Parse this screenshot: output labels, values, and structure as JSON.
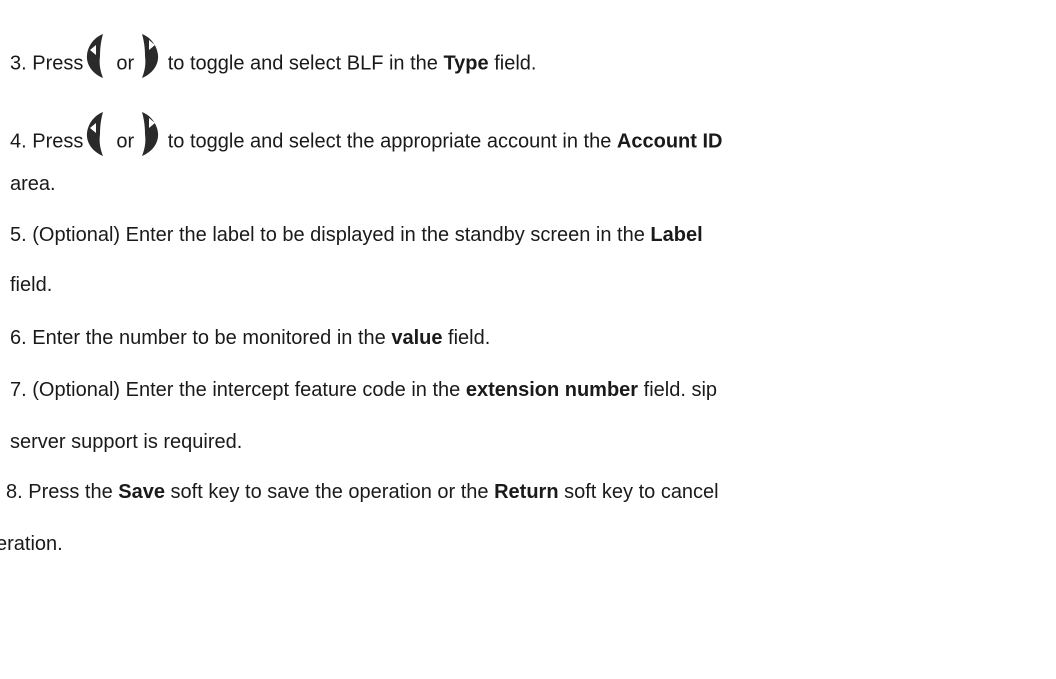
{
  "steps": [
    {
      "id": "step3",
      "parts": [
        {
          "t": "text",
          "v": "3. Press"
        },
        {
          "t": "icon",
          "v": "left-navigation-key-icon"
        },
        {
          "t": "text",
          "v": "or"
        },
        {
          "t": "icon",
          "v": "right-navigation-key-icon"
        },
        {
          "t": "text",
          "v": " to toggle and select BLF in the "
        },
        {
          "t": "bold",
          "v": "Type"
        },
        {
          "t": "text",
          "v": " field."
        }
      ]
    },
    {
      "id": "step4",
      "parts": [
        {
          "t": "text",
          "v": "4. Press"
        },
        {
          "t": "icon",
          "v": "left-navigation-key-icon"
        },
        {
          "t": "text",
          "v": "or"
        },
        {
          "t": "icon",
          "v": "right-navigation-key-icon"
        },
        {
          "t": "text",
          "v": " to toggle and select the appropriate account in the "
        },
        {
          "t": "bold",
          "v": "Account ID"
        }
      ]
    },
    {
      "id": "step4-cont",
      "parts": [
        {
          "t": "text",
          "v": "area."
        }
      ]
    },
    {
      "id": "step5",
      "parts": [
        {
          "t": "text",
          "v": "5. (Optional) Enter the label to be displayed in the standby screen in the "
        },
        {
          "t": "bold",
          "v": "Label"
        }
      ]
    },
    {
      "id": "step5-cont",
      "parts": [
        {
          "t": "text",
          "v": "field."
        }
      ]
    },
    {
      "id": "step6",
      "parts": [
        {
          "t": "text",
          "v": "6. Enter the number to be monitored in the "
        },
        {
          "t": "bold",
          "v": "value"
        },
        {
          "t": "text",
          "v": " field."
        }
      ]
    },
    {
      "id": "step7",
      "parts": [
        {
          "t": "text",
          "v": "7. (Optional) Enter the intercept feature code in the "
        },
        {
          "t": "bold",
          "v": "extension number"
        },
        {
          "t": "text",
          "v": " field. sip"
        }
      ]
    },
    {
      "id": "step7-cont",
      "parts": [
        {
          "t": "text",
          "v": "server support is required."
        }
      ]
    },
    {
      "id": "step8",
      "parts": [
        {
          "t": "text",
          "v": " 8. Press the "
        },
        {
          "t": "bold",
          "v": "Save"
        },
        {
          "t": "text",
          "v": " soft key to save the operation or the "
        },
        {
          "t": "bold",
          "v": "Return"
        },
        {
          "t": "text",
          "v": " soft key to cancel"
        }
      ]
    },
    {
      "id": "step8-cont",
      "parts": [
        {
          "t": "text",
          "v": "eration."
        }
      ]
    }
  ]
}
